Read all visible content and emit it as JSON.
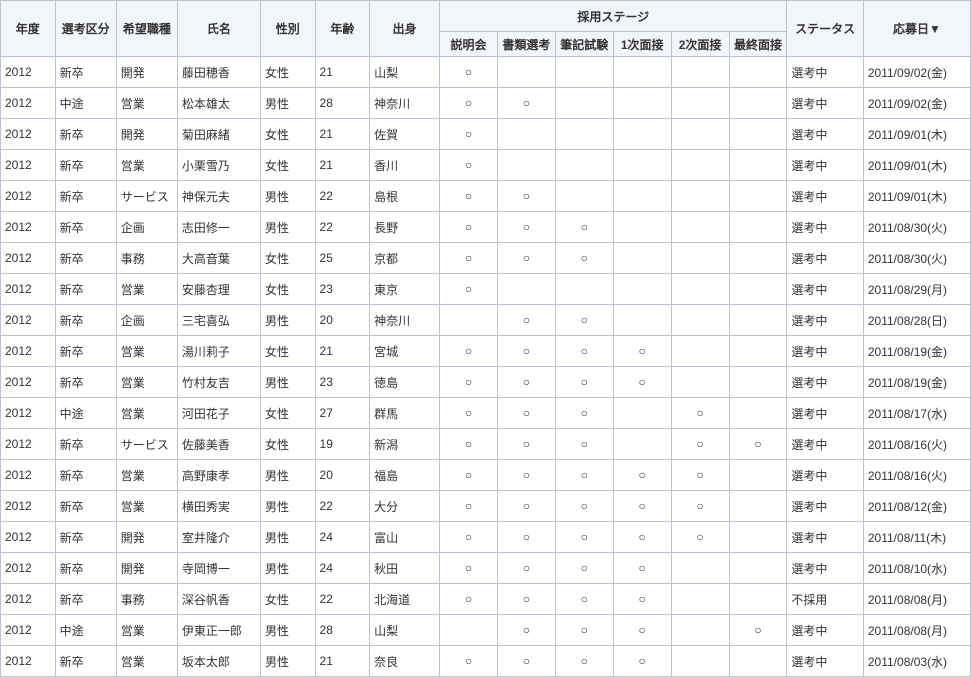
{
  "headers": {
    "year": "年度",
    "type": "選考区分",
    "job": "希望職種",
    "name": "氏名",
    "gender": "性別",
    "age": "年齢",
    "origin": "出身",
    "stage_group": "採用ステージ",
    "status": "ステータス",
    "date": "応募日▼",
    "stages": [
      "説明会",
      "書類選考",
      "筆記試験",
      "1次面接",
      "2次面接",
      "最終面接"
    ]
  },
  "mark": "○",
  "rows": [
    {
      "year": "2012",
      "type": "新卒",
      "job": "開発",
      "name": "藤田穂香",
      "gender": "女性",
      "age": "21",
      "origin": "山梨",
      "stages": [
        1,
        0,
        0,
        0,
        0,
        0
      ],
      "status": "選考中",
      "date": "2011/09/02(金)"
    },
    {
      "year": "2012",
      "type": "中途",
      "job": "営業",
      "name": "松本雄太",
      "gender": "男性",
      "age": "28",
      "origin": "神奈川",
      "stages": [
        1,
        1,
        0,
        0,
        0,
        0
      ],
      "status": "選考中",
      "date": "2011/09/02(金)"
    },
    {
      "year": "2012",
      "type": "新卒",
      "job": "開発",
      "name": "菊田麻緒",
      "gender": "女性",
      "age": "21",
      "origin": "佐賀",
      "stages": [
        1,
        0,
        0,
        0,
        0,
        0
      ],
      "status": "選考中",
      "date": "2011/09/01(木)"
    },
    {
      "year": "2012",
      "type": "新卒",
      "job": "営業",
      "name": "小栗雪乃",
      "gender": "女性",
      "age": "21",
      "origin": "香川",
      "stages": [
        1,
        0,
        0,
        0,
        0,
        0
      ],
      "status": "選考中",
      "date": "2011/09/01(木)"
    },
    {
      "year": "2012",
      "type": "新卒",
      "job": "サービス",
      "name": "神保元夫",
      "gender": "男性",
      "age": "22",
      "origin": "島根",
      "stages": [
        1,
        1,
        0,
        0,
        0,
        0
      ],
      "status": "選考中",
      "date": "2011/09/01(木)"
    },
    {
      "year": "2012",
      "type": "新卒",
      "job": "企画",
      "name": "志田修一",
      "gender": "男性",
      "age": "22",
      "origin": "長野",
      "stages": [
        1,
        1,
        1,
        0,
        0,
        0
      ],
      "status": "選考中",
      "date": "2011/08/30(火)"
    },
    {
      "year": "2012",
      "type": "新卒",
      "job": "事務",
      "name": "大高音葉",
      "gender": "女性",
      "age": "25",
      "origin": "京都",
      "stages": [
        1,
        1,
        1,
        0,
        0,
        0
      ],
      "status": "選考中",
      "date": "2011/08/30(火)"
    },
    {
      "year": "2012",
      "type": "新卒",
      "job": "営業",
      "name": "安藤杏理",
      "gender": "女性",
      "age": "23",
      "origin": "東京",
      "stages": [
        1,
        0,
        0,
        0,
        0,
        0
      ],
      "status": "選考中",
      "date": "2011/08/29(月)"
    },
    {
      "year": "2012",
      "type": "新卒",
      "job": "企画",
      "name": "三宅喜弘",
      "gender": "男性",
      "age": "20",
      "origin": "神奈川",
      "stages": [
        0,
        1,
        1,
        0,
        0,
        0
      ],
      "status": "選考中",
      "date": "2011/08/28(日)"
    },
    {
      "year": "2012",
      "type": "新卒",
      "job": "営業",
      "name": "湯川莉子",
      "gender": "女性",
      "age": "21",
      "origin": "宮城",
      "stages": [
        1,
        1,
        1,
        1,
        0,
        0
      ],
      "status": "選考中",
      "date": "2011/08/19(金)"
    },
    {
      "year": "2012",
      "type": "新卒",
      "job": "営業",
      "name": "竹村友吉",
      "gender": "男性",
      "age": "23",
      "origin": "徳島",
      "stages": [
        1,
        1,
        1,
        1,
        0,
        0
      ],
      "status": "選考中",
      "date": "2011/08/19(金)"
    },
    {
      "year": "2012",
      "type": "中途",
      "job": "営業",
      "name": "河田花子",
      "gender": "女性",
      "age": "27",
      "origin": "群馬",
      "stages": [
        1,
        1,
        1,
        0,
        1,
        0
      ],
      "status": "選考中",
      "date": "2011/08/17(水)"
    },
    {
      "year": "2012",
      "type": "新卒",
      "job": "サービス",
      "name": "佐藤美香",
      "gender": "女性",
      "age": "19",
      "origin": "新潟",
      "stages": [
        1,
        1,
        1,
        0,
        1,
        1
      ],
      "status": "選考中",
      "date": "2011/08/16(火)"
    },
    {
      "year": "2012",
      "type": "新卒",
      "job": "営業",
      "name": "高野康孝",
      "gender": "男性",
      "age": "20",
      "origin": "福島",
      "stages": [
        1,
        1,
        1,
        1,
        1,
        0
      ],
      "status": "選考中",
      "date": "2011/08/16(火)"
    },
    {
      "year": "2012",
      "type": "新卒",
      "job": "営業",
      "name": "横田秀実",
      "gender": "男性",
      "age": "22",
      "origin": "大分",
      "stages": [
        1,
        1,
        1,
        1,
        1,
        0
      ],
      "status": "選考中",
      "date": "2011/08/12(金)"
    },
    {
      "year": "2012",
      "type": "新卒",
      "job": "開発",
      "name": "室井隆介",
      "gender": "男性",
      "age": "24",
      "origin": "富山",
      "stages": [
        1,
        1,
        1,
        1,
        1,
        0
      ],
      "status": "選考中",
      "date": "2011/08/11(木)"
    },
    {
      "year": "2012",
      "type": "新卒",
      "job": "開発",
      "name": "寺岡博一",
      "gender": "男性",
      "age": "24",
      "origin": "秋田",
      "stages": [
        1,
        1,
        1,
        1,
        0,
        0
      ],
      "status": "選考中",
      "date": "2011/08/10(水)"
    },
    {
      "year": "2012",
      "type": "新卒",
      "job": "事務",
      "name": "深谷帆香",
      "gender": "女性",
      "age": "22",
      "origin": "北海道",
      "stages": [
        1,
        1,
        1,
        1,
        0,
        0
      ],
      "status": "不採用",
      "date": "2011/08/08(月)"
    },
    {
      "year": "2012",
      "type": "中途",
      "job": "営業",
      "name": "伊東正一郎",
      "gender": "男性",
      "age": "28",
      "origin": "山梨",
      "stages": [
        0,
        1,
        1,
        1,
        0,
        1
      ],
      "status": "選考中",
      "date": "2011/08/08(月)"
    },
    {
      "year": "2012",
      "type": "新卒",
      "job": "営業",
      "name": "坂本太郎",
      "gender": "男性",
      "age": "21",
      "origin": "奈良",
      "stages": [
        1,
        1,
        1,
        1,
        0,
        0
      ],
      "status": "選考中",
      "date": "2011/08/03(水)"
    }
  ]
}
